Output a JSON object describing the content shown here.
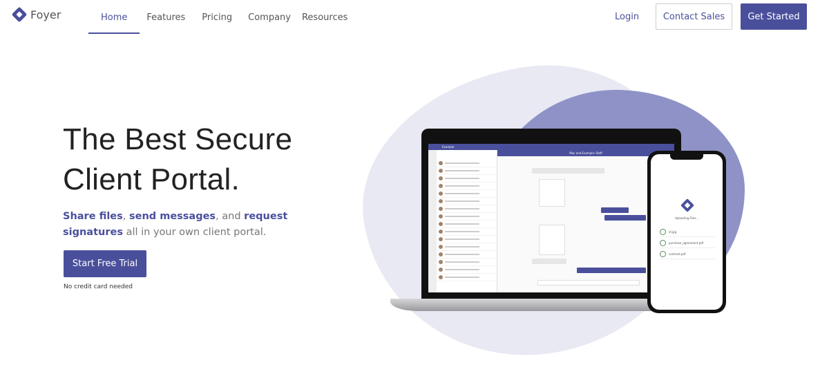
{
  "brand": {
    "name": "Foyer",
    "color": "#4a4f9c"
  },
  "nav": {
    "items": [
      "Home",
      "Features",
      "Pricing",
      "Company",
      "Resources"
    ],
    "active": "Home"
  },
  "header": {
    "login": "Login",
    "contact_sales": "Contact Sales",
    "get_started": "Get Started"
  },
  "hero": {
    "title_line1": "The Best Secure",
    "title_line2": "Client Portal.",
    "sub": {
      "p1": "Share files",
      "s1": ", ",
      "p2": "send messages",
      "s2": ", and ",
      "p3": "request signatures",
      "s3": " all in your own client portal."
    },
    "cta": "Start Free Trial",
    "note": "No credit card needed"
  },
  "mockup": {
    "laptop": {
      "app_name": "Example",
      "chat_title": "Mac and Example: Staff"
    },
    "phone": {
      "title": "Uploading Files...",
      "files": [
        "id.jpg",
        "purchase_agreement.pdf",
        "contract.pdf"
      ]
    }
  }
}
